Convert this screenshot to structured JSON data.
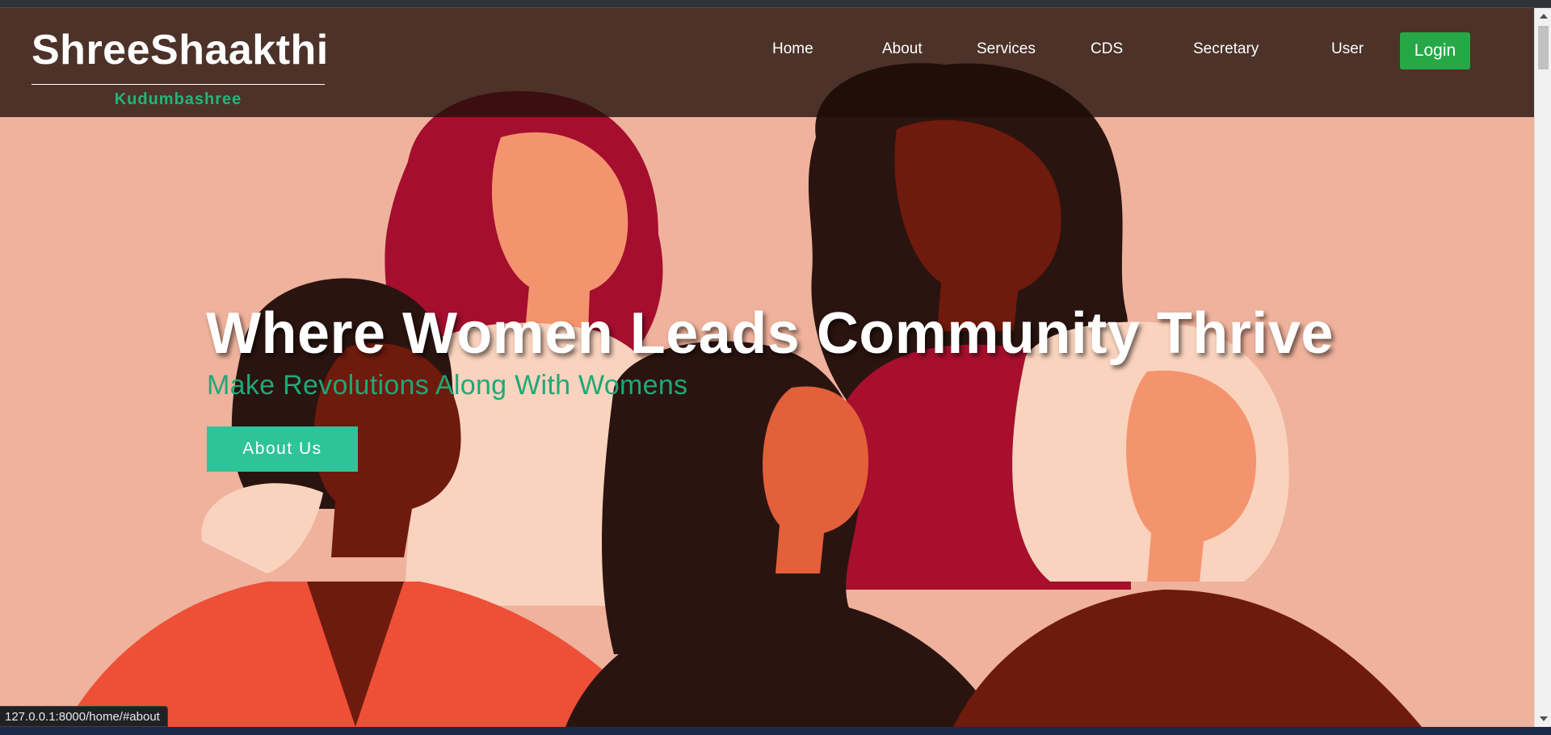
{
  "brand": {
    "title": "ShreeShaakthi",
    "subtitle": "Kudumbashree"
  },
  "nav": {
    "items": [
      "Home",
      "About",
      "Services",
      "CDS",
      "Secretary",
      "User"
    ],
    "login_label": "Login"
  },
  "hero": {
    "title": "Where Women Leads Community Thrive",
    "subtitle": "Make Revolutions Along With Womens",
    "cta_label": "About Us"
  },
  "status_bar": {
    "url": "127.0.0.1:8000/home/#about"
  },
  "colors": {
    "background_peach": "#efb29c",
    "nav_overlay": "#2a1a12",
    "brand_accent": "#20b67a",
    "login_button": "#26a846",
    "cta_button": "#2ec49a"
  }
}
